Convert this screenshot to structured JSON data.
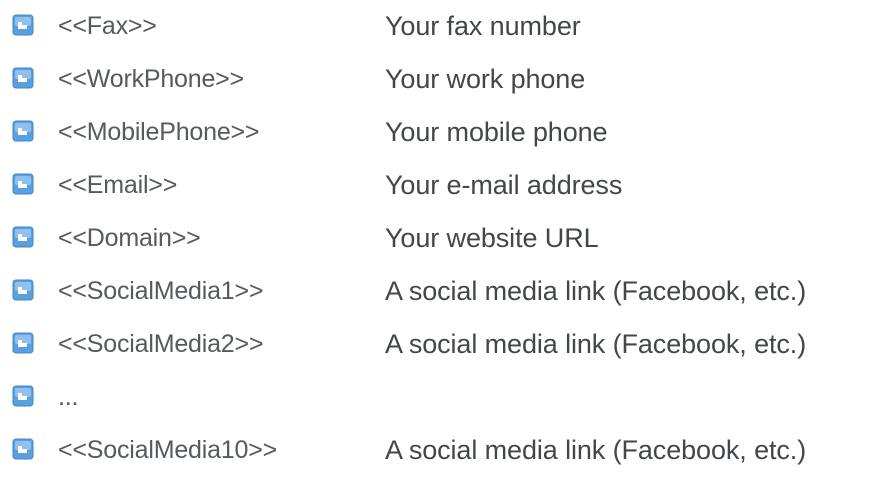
{
  "fields": [
    {
      "token": "<<Fax>>",
      "description": "Your fax number"
    },
    {
      "token": "<<WorkPhone>>",
      "description": "Your work phone"
    },
    {
      "token": "<<MobilePhone>>",
      "description": "Your mobile phone"
    },
    {
      "token": "<<Email>>",
      "description": "Your e-mail address"
    },
    {
      "token": "<<Domain>>",
      "description": "Your website URL"
    },
    {
      "token": "<<SocialMedia1>>",
      "description": "A social media link (Facebook, etc.)"
    },
    {
      "token": "<<SocialMedia2>>",
      "description": "A social media link (Facebook, etc.)"
    },
    {
      "token": "...",
      "description": ""
    },
    {
      "token": "<<SocialMedia10>>",
      "description": "A social media link (Facebook, etc.)"
    }
  ],
  "colors": {
    "bullet_fill": "#5aa0e0",
    "bullet_highlight": "#cfe4f7",
    "token_text": "#555a60",
    "description_text": "#43474c"
  },
  "icons": {
    "bullet": "blue-square-bullet-icon"
  }
}
